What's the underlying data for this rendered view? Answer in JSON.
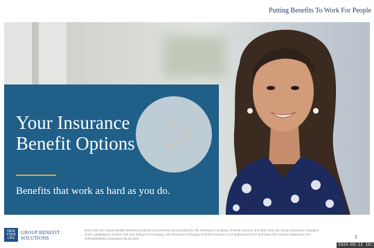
{
  "header": {
    "tagline": "Putting Benefits To Work For People"
  },
  "hero": {
    "title": "Your Insurance\nBenefit Options",
    "subtitle": "Benefits that work as hard as you do.",
    "accent_color": "#e8a33a",
    "panel_color": "#1f5f88",
    "play_icon": "play-icon"
  },
  "footer": {
    "logo_text": "NEW YORK LIFE",
    "brand": "Group Benefit\nSolutions",
    "disclaimer": "New York Life Group Benefit Solutions products and services are provided by Life Insurance Company of North America and New York Life Group Insurance Company of NY, subsidiaries of New York Life Insurance Company. Life Insurance Company of North America is not authorized in NY and does not conduct business in NY. SHRU00080413 Expiration 06.25.2027",
    "page_number": "1",
    "timestamp": "2024-09-12 18:1"
  }
}
